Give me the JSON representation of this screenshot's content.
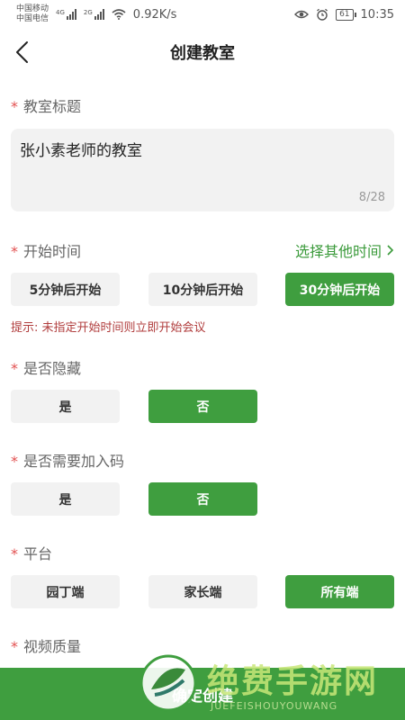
{
  "status_bar": {
    "carrier1": "中国移动",
    "carrier2": "中国电信",
    "net1": "4G",
    "net2": "2G",
    "speed": "0.92K/s",
    "battery": "61",
    "time": "10:35"
  },
  "nav": {
    "title": "创建教室"
  },
  "form": {
    "room_title": {
      "label": "教室标题",
      "value": "张小素老师的教室",
      "count": "8/28"
    },
    "start_time": {
      "label": "开始时间",
      "other_time": "选择其他时间",
      "options": [
        "5分钟后开始",
        "10分钟后开始",
        "30分钟后开始"
      ],
      "selected_index": 2,
      "hint": "提示: 未指定开始时间则立即开始会议"
    },
    "hidden": {
      "label": "是否隐藏",
      "options": [
        "是",
        "否"
      ],
      "selected_index": 1
    },
    "join_code": {
      "label": "是否需要加入码",
      "options": [
        "是",
        "否"
      ],
      "selected_index": 1
    },
    "platform": {
      "label": "平台",
      "options": [
        "园丁端",
        "家长端",
        "所有端"
      ],
      "selected_index": 2
    },
    "video_quality": {
      "label": "视频质量"
    }
  },
  "bottom": {
    "create_label": "确定创建"
  },
  "watermark": {
    "title": "绝费手游网",
    "subtitle": "JUEFEISHOUYOUWANG"
  },
  "colors": {
    "accent": "#3f9e3f",
    "required": "#e25050",
    "hint": "#b03c3c",
    "field_bg": "#f2f2f2"
  },
  "icons": {
    "back": "chevron-left-icon",
    "other_time_arrow": "chevron-right-icon"
  }
}
